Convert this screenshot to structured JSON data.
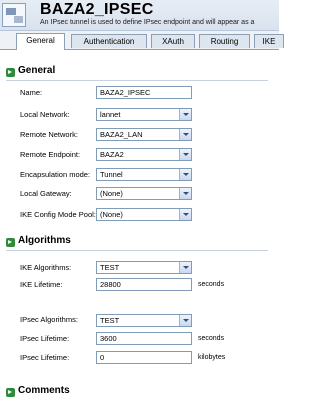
{
  "header": {
    "title": "BAZA2_IPSEC",
    "subtitle": "An IPsec tunnel is used to define IPsec endpoint and will appear as a"
  },
  "tabs": [
    {
      "label": "General",
      "active": true
    },
    {
      "label": "Authentication",
      "active": false
    },
    {
      "label": "XAuth",
      "active": false
    },
    {
      "label": "Routing",
      "active": false
    },
    {
      "label": "IKE",
      "active": false
    }
  ],
  "general": {
    "title": "General",
    "fields": {
      "name": {
        "label": "Name:",
        "value": "BAZA2_IPSEC"
      },
      "local_network": {
        "label": "Local Network:",
        "value": "lannet"
      },
      "remote_network": {
        "label": "Remote Network:",
        "value": "BAZA2_LAN"
      },
      "remote_endpoint": {
        "label": "Remote Endpoint:",
        "value": "BAZA2"
      },
      "encapsulation_mode": {
        "label": "Encapsulation mode:",
        "value": "Tunnel"
      },
      "local_gateway": {
        "label": "Local Gateway:",
        "value": "(None)"
      },
      "ike_config_mode_pool": {
        "label": "IKE Config Mode Pool:",
        "value": "(None)"
      }
    }
  },
  "algorithms": {
    "title": "Algorithms",
    "fields": {
      "ike_algorithms": {
        "label": "IKE Algorithms:",
        "value": "TEST"
      },
      "ike_lifetime": {
        "label": "IKE Lifetime:",
        "value": "28800",
        "unit": "seconds"
      },
      "ipsec_algorithms": {
        "label": "IPsec Algorithms:",
        "value": "TEST"
      },
      "ipsec_lifetime_seconds": {
        "label": "IPsec Lifetime:",
        "value": "3600",
        "unit": "seconds"
      },
      "ipsec_lifetime_kilobytes": {
        "label": "IPsec Lifetime:",
        "value": "0",
        "unit": "kilobytes"
      }
    }
  },
  "comments": {
    "title": "Comments"
  }
}
